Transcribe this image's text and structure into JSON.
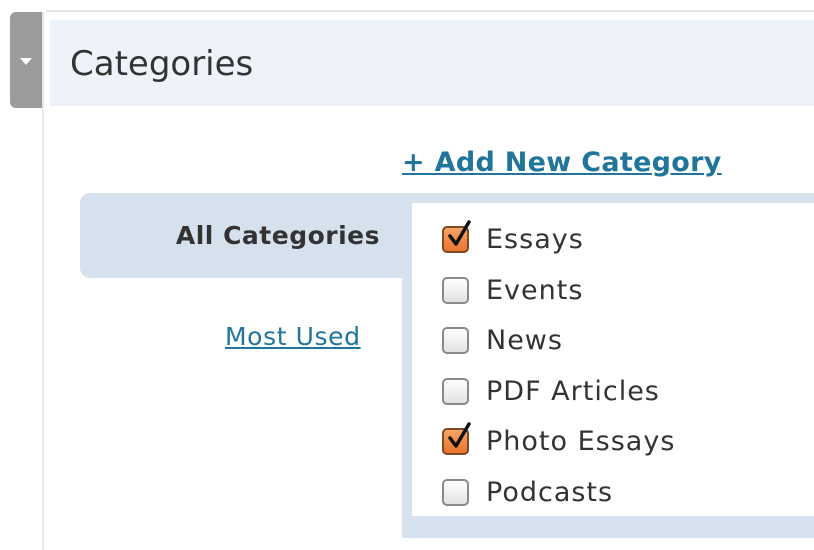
{
  "panel": {
    "title": "Categories",
    "toggle_icon": "chevron-down-icon"
  },
  "add_new_link": "+ Add New Category",
  "tabs": {
    "all": "All Categories",
    "most_used": "Most Used"
  },
  "categories": [
    {
      "label": "Essays",
      "checked": true
    },
    {
      "label": "Events",
      "checked": false
    },
    {
      "label": "News",
      "checked": false
    },
    {
      "label": "PDF Articles",
      "checked": false
    },
    {
      "label": "Photo Essays",
      "checked": true
    },
    {
      "label": "Podcasts",
      "checked": false
    }
  ],
  "colors": {
    "accent": "#e8742d",
    "link": "#21759b",
    "header_bg": "#eef3fa",
    "tab_bg": "#d5e2ed"
  }
}
